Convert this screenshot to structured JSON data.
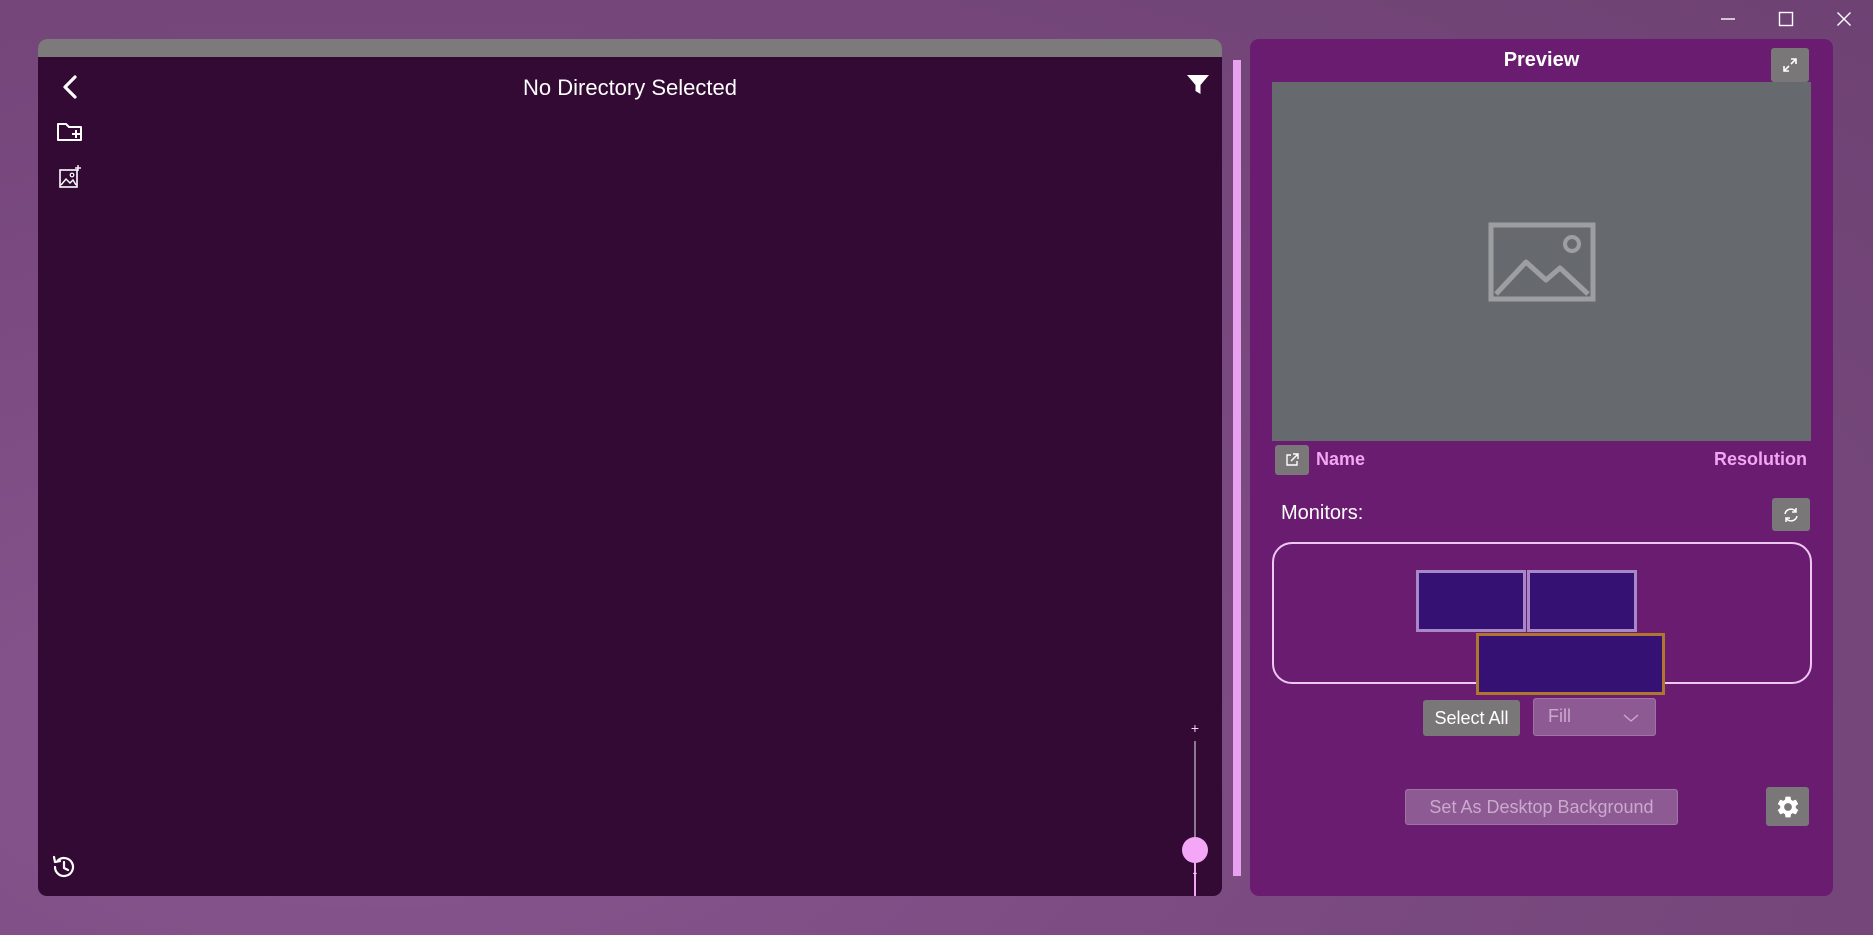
{
  "window": {
    "controls": [
      "minimize-icon",
      "maximize-icon",
      "close-icon"
    ]
  },
  "browser": {
    "directory_title": "No Directory Selected",
    "zoom_plus": "+",
    "zoom_minus": "-",
    "zoom_level": 0.3,
    "icons": [
      "back-icon",
      "add-folder-icon",
      "add-image-icon",
      "filter-icon",
      "history-icon"
    ]
  },
  "preview": {
    "title": "Preview",
    "name_label": "Name",
    "resolution_label": "Resolution",
    "monitors_label": "Monitors:",
    "monitors": [
      {
        "id": "monitor-1",
        "selected": false
      },
      {
        "id": "monitor-2",
        "selected": false
      },
      {
        "id": "monitor-3",
        "selected": true
      }
    ],
    "select_all_label": "Select All",
    "fit_mode_value": "Fill",
    "set_background_label": "Set As Desktop Background"
  },
  "colors": {
    "accent": "#f4a6f7",
    "panel_left": "#320a33",
    "panel_right": "#6a1c70",
    "monitor_fill": "#351173",
    "monitor_selected_border": "#b1762d"
  }
}
